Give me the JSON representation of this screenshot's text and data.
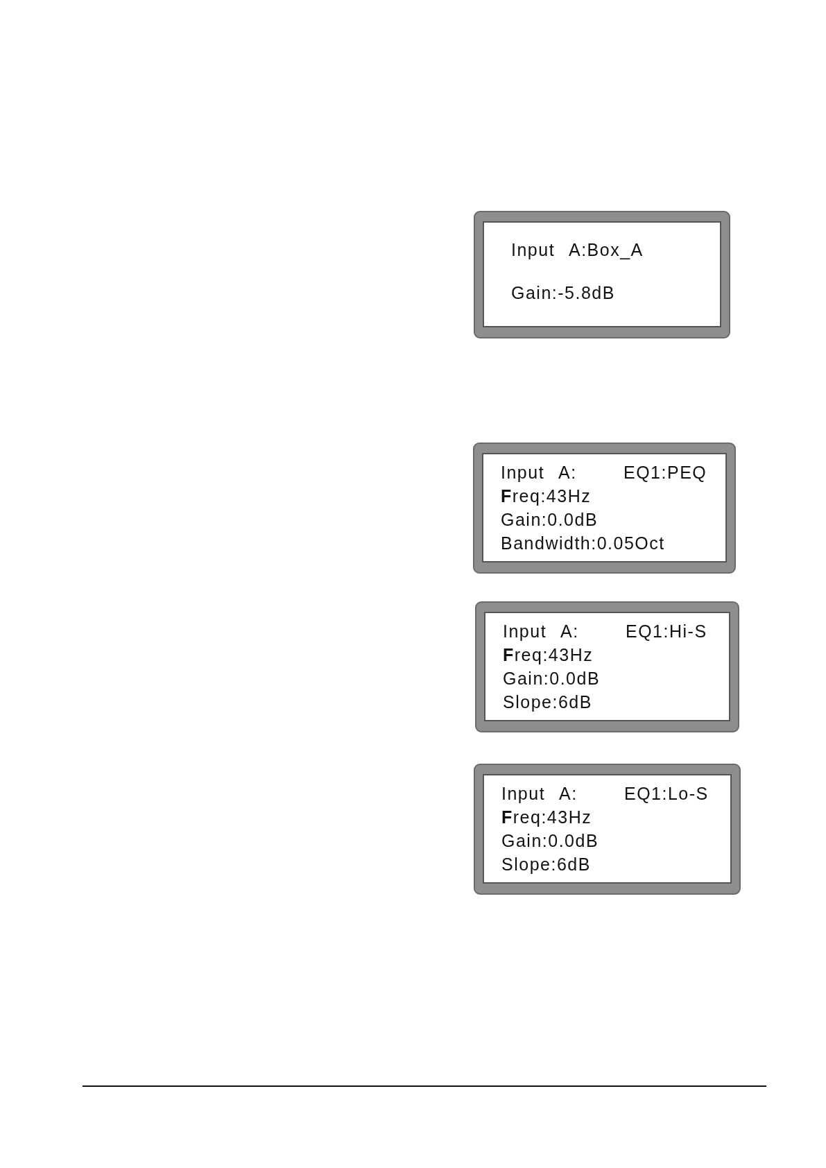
{
  "displays": [
    {
      "header": [
        "Input",
        "A:Box_A"
      ],
      "lines": [
        "Gain:-5.8dB"
      ]
    },
    {
      "header": [
        "Input",
        "A:",
        "EQ1:PEQ"
      ],
      "lines": [
        "**F**req:43Hz",
        "Gain:0.0dB",
        "Bandwidth:0.05Oct"
      ]
    },
    {
      "header": [
        "Input",
        "A:",
        "EQ1:Hi-S"
      ],
      "lines": [
        "**F**req:43Hz",
        "Gain:0.0dB",
        "Slope:6dB"
      ]
    },
    {
      "header": [
        "Input",
        "A:",
        "EQ1:Lo-S"
      ],
      "lines": [
        "**F**req:43Hz",
        "Gain:0.0dB",
        "Slope:6dB"
      ]
    }
  ]
}
